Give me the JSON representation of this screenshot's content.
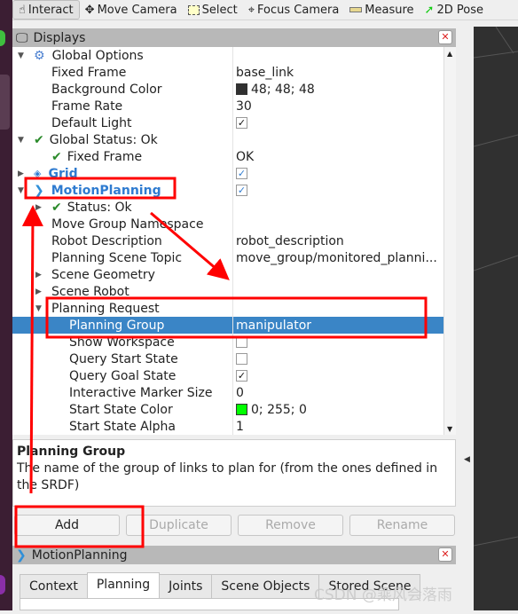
{
  "toolbar": {
    "tools": [
      {
        "label": "Interact",
        "icon": "hand-pointer-icon",
        "active": true
      },
      {
        "label": "Move Camera",
        "icon": "move-camera-icon"
      },
      {
        "label": "Select",
        "icon": "select-rect-icon"
      },
      {
        "label": "Focus Camera",
        "icon": "focus-camera-icon"
      },
      {
        "label": "Measure",
        "icon": "ruler-icon"
      },
      {
        "label": "2D Pose",
        "icon": "green-arrow-icon"
      }
    ]
  },
  "displays": {
    "title": "Displays",
    "rows": [
      {
        "name": "Global Options",
        "value": ""
      },
      {
        "name": "Fixed Frame",
        "value": "base_link"
      },
      {
        "name": "Background Color",
        "value": "48; 48; 48",
        "color": "#303030"
      },
      {
        "name": "Frame Rate",
        "value": "30"
      },
      {
        "name": "Default Light",
        "checked": true
      },
      {
        "name": "Global Status: Ok",
        "value": ""
      },
      {
        "name": "Fixed Frame",
        "value": "OK"
      },
      {
        "name": "Grid",
        "checked": true
      },
      {
        "name": "MotionPlanning",
        "checked": true
      },
      {
        "name": "Status: Ok",
        "value": ""
      },
      {
        "name": "Move Group Namespace",
        "value": ""
      },
      {
        "name": "Robot Description",
        "value": "robot_description"
      },
      {
        "name": "Planning Scene Topic",
        "value": "move_group/monitored_planni..."
      },
      {
        "name": "Scene Geometry",
        "value": ""
      },
      {
        "name": "Scene Robot",
        "value": ""
      },
      {
        "name": "Planning Request",
        "value": ""
      },
      {
        "name": "Planning Group",
        "value": "manipulator"
      },
      {
        "name": "Show Workspace",
        "checked": false
      },
      {
        "name": "Query Start State",
        "checked": false
      },
      {
        "name": "Query Goal State",
        "checked": true
      },
      {
        "name": "Interactive Marker Size",
        "value": "0"
      },
      {
        "name": "Start State Color",
        "value": "0; 255; 0",
        "color": "#00ff00"
      },
      {
        "name": "Start State Alpha",
        "value": "1"
      }
    ]
  },
  "description": {
    "title": "Planning Group",
    "text": "The name of the group of links to plan for (from the ones defined in the SRDF)"
  },
  "buttons": {
    "add": "Add",
    "duplicate": "Duplicate",
    "remove": "Remove",
    "rename": "Rename"
  },
  "motion_panel": {
    "title": "MotionPlanning",
    "tabs": [
      "Context",
      "Planning",
      "Joints",
      "Scene Objects",
      "Stored Scene"
    ],
    "active_tab": "Planning"
  },
  "watermark": "CSDN @乘风会落雨",
  "annotation_color": "#ff0000",
  "selection_color": "#3a85c6"
}
